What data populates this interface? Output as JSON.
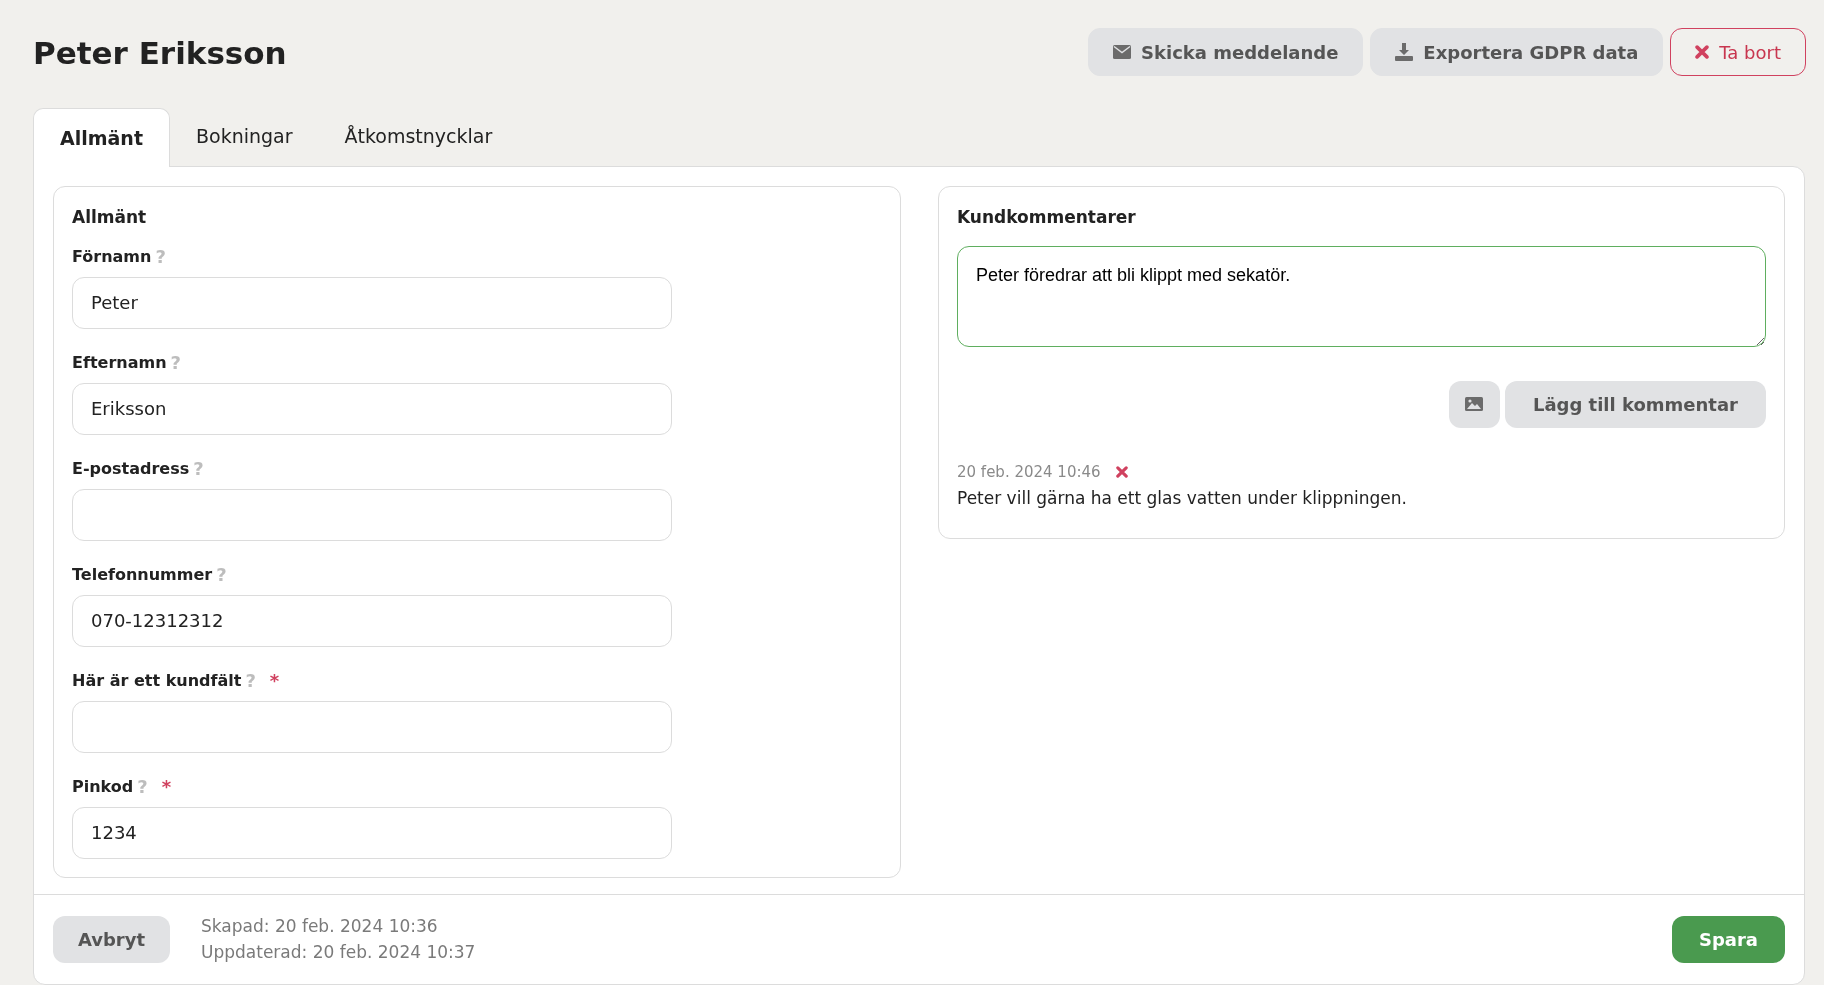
{
  "header": {
    "title": "Peter Eriksson",
    "actions": [
      {
        "kind": "message",
        "label": "Skicka meddelande"
      },
      {
        "kind": "export",
        "label": "Exportera GDPR data"
      },
      {
        "kind": "delete",
        "label": "Ta bort"
      }
    ]
  },
  "tabs": [
    {
      "label": "Allmänt",
      "selected": true
    },
    {
      "label": "Bokningar",
      "selected": false
    },
    {
      "label": "Åtkomstnycklar",
      "selected": false
    }
  ],
  "general": {
    "title": "Allmänt",
    "fields": [
      {
        "label": "Förnamn",
        "help": "?",
        "value": "Peter"
      },
      {
        "label": "Efternamn",
        "help": "?",
        "value": "Eriksson"
      },
      {
        "label": "E-postadress",
        "help": "?"
      },
      {
        "label": "Telefonnummer",
        "help": "?",
        "value": "070-12312312"
      },
      {
        "label": "Här är ett kundfält",
        "help": "?",
        "required_mark": "*"
      },
      {
        "label": "Pinkod",
        "help": "?",
        "required_mark": "*",
        "value": "1234"
      }
    ]
  },
  "comments": {
    "title": "Kundkommentarer",
    "draft": "Peter föredrar att bli klippt med sekatör.",
    "add_button": "Lägg till kommentar",
    "items": [
      {
        "time": "20 feb. 2024 10:46",
        "text": "Peter vill gärna ha ett glas vatten under klippningen."
      }
    ]
  },
  "footer": {
    "cancel": "Avbryt",
    "created": "Skapad: 20 feb. 2024 10:36",
    "updated": "Uppdaterad: 20 feb. 2024 10:37",
    "save": "Spara"
  }
}
